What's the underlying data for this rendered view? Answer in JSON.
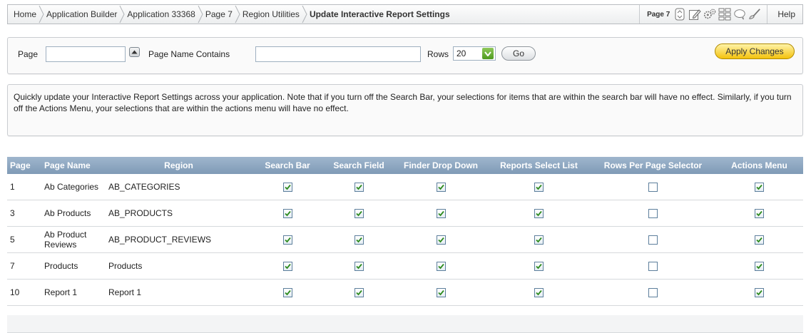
{
  "breadcrumb": {
    "items": [
      "Home",
      "Application Builder",
      "Application 33368",
      "Page 7",
      "Region Utilities"
    ],
    "current": "Update Interactive Report Settings"
  },
  "page_tools": {
    "page_label": "Page 7",
    "icons": [
      "page-nav-icon",
      "edit-page-icon",
      "shared-components-icon",
      "page-grid-icon",
      "comment-icon",
      "developer-tools-icon"
    ]
  },
  "help_label": "Help",
  "filter": {
    "page_label": "Page",
    "page_value": "",
    "page_name_label": "Page Name Contains",
    "page_name_value": "",
    "rows_label": "Rows",
    "rows_value": "20",
    "go_label": "Go",
    "apply_label": "Apply Changes"
  },
  "note_text": "Quickly update your Interactive Report Settings across your application. Note that if you turn off the Search Bar, your selections for items that are within the search bar will have no effect. Similarly, if you turn off the Actions Menu, your selections that are within the actions menu will have no effect.",
  "table": {
    "headers": [
      "Page",
      "Page Name",
      "Region",
      "Search Bar",
      "Search Field",
      "Finder Drop Down",
      "Reports Select List",
      "Rows Per Page Selector",
      "Actions Menu"
    ],
    "rows": [
      {
        "page": "1",
        "page_name": "Ab Categories",
        "region": "AB_CATEGORIES",
        "checks": [
          true,
          true,
          true,
          true,
          false,
          true
        ]
      },
      {
        "page": "3",
        "page_name": "Ab Products",
        "region": "AB_PRODUCTS",
        "checks": [
          true,
          true,
          true,
          true,
          false,
          true
        ]
      },
      {
        "page": "5",
        "page_name": "Ab Product Reviews",
        "region": "AB_PRODUCT_REVIEWS",
        "checks": [
          true,
          true,
          true,
          true,
          false,
          true
        ]
      },
      {
        "page": "7",
        "page_name": "Products",
        "region": "Products",
        "checks": [
          true,
          true,
          true,
          true,
          false,
          true
        ]
      },
      {
        "page": "10",
        "page_name": "Report 1",
        "region": "Report 1",
        "checks": [
          true,
          true,
          true,
          true,
          false,
          true
        ]
      }
    ]
  },
  "colors": {
    "header_bg": "#8aa3bd",
    "apply_button": "#f4c20d",
    "checkmark": "#2e8b1e"
  }
}
